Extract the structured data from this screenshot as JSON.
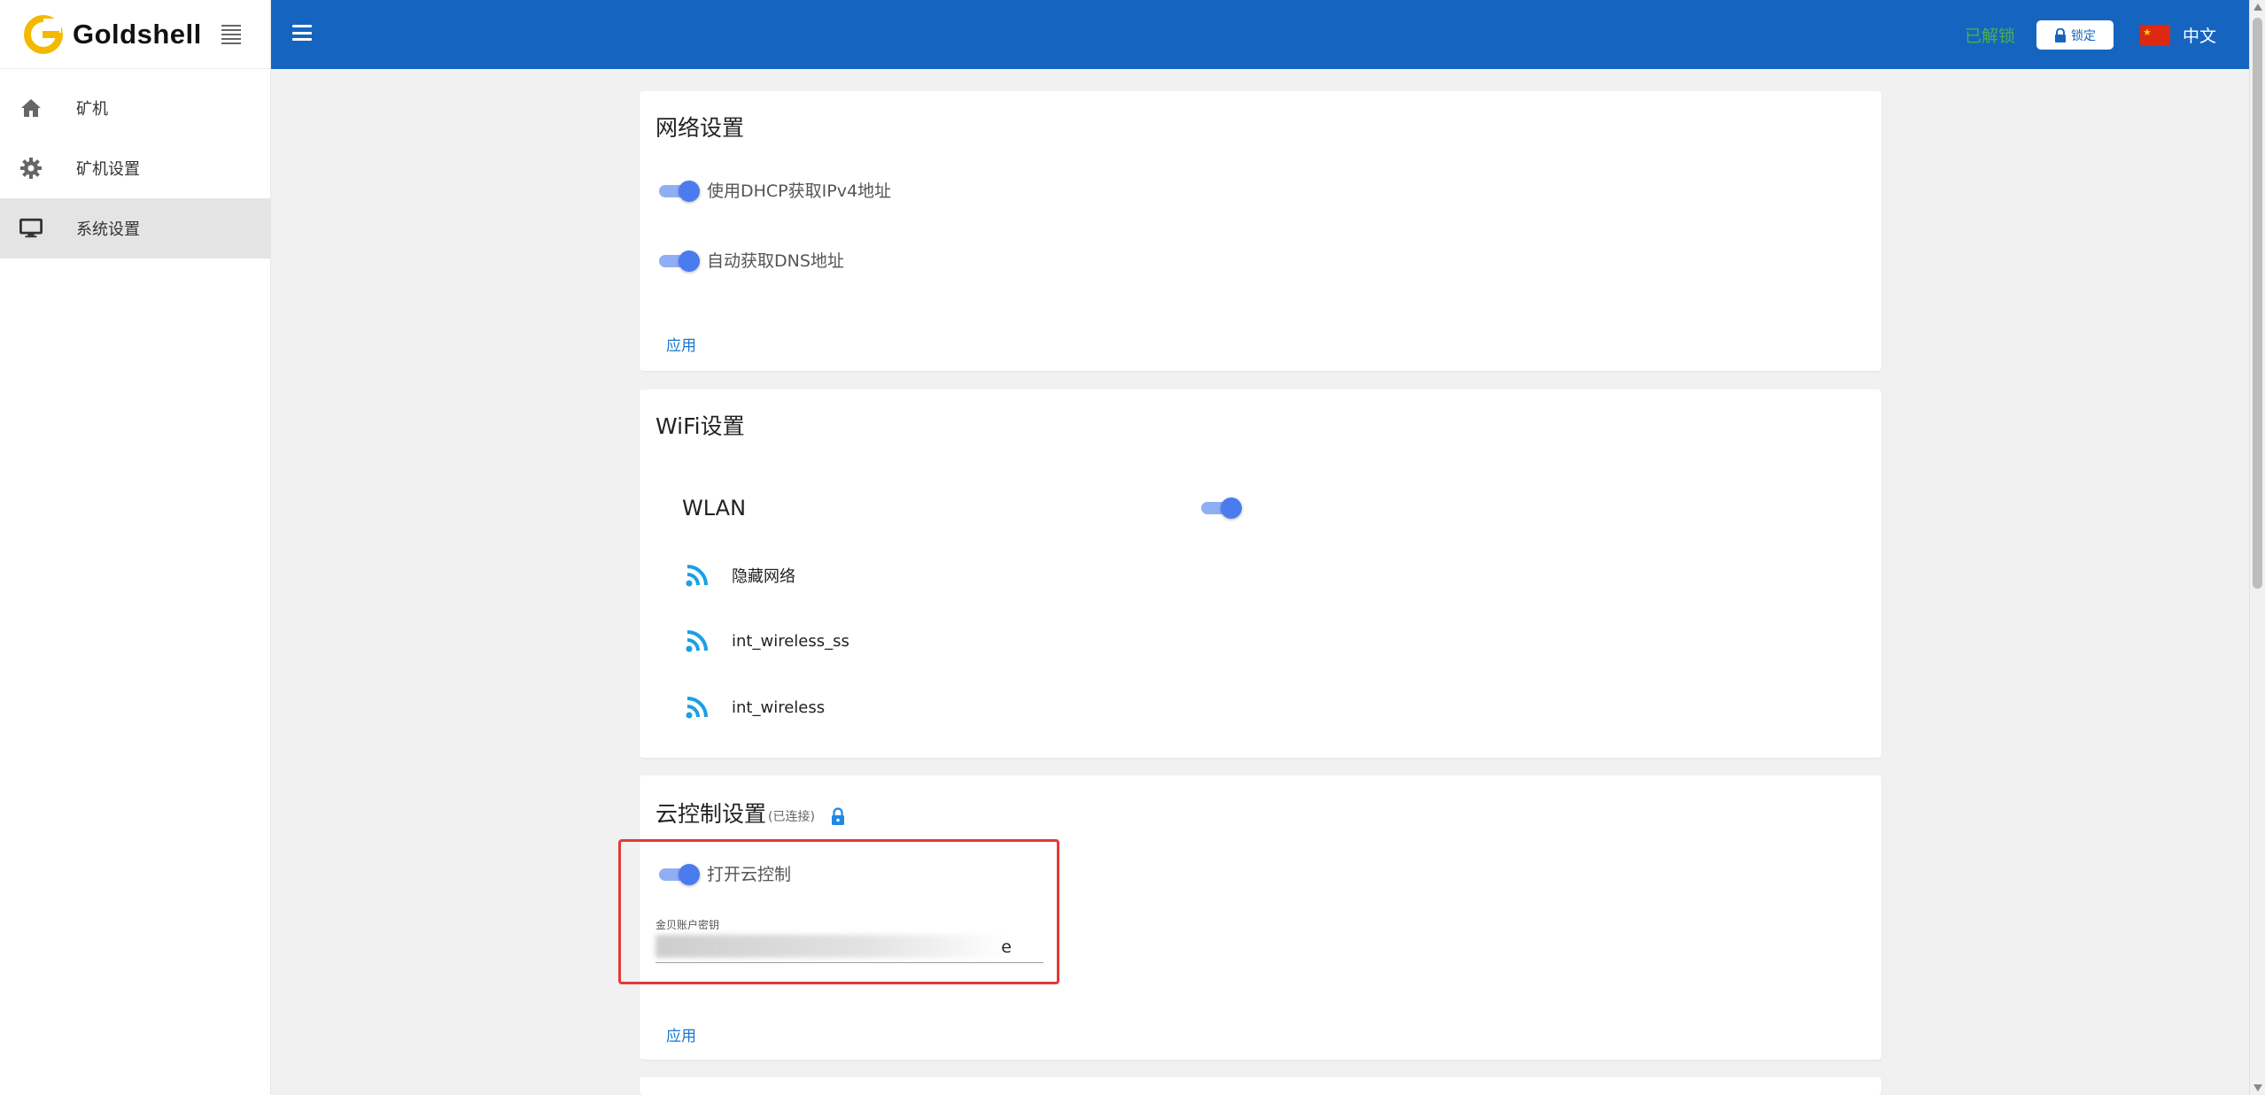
{
  "brand": {
    "name": "Goldshell"
  },
  "sidebar": {
    "items": [
      {
        "label": "矿机",
        "icon": "home-icon"
      },
      {
        "label": "矿机设置",
        "icon": "gear-icon"
      },
      {
        "label": "系统设置",
        "icon": "monitor-icon",
        "active": true
      }
    ]
  },
  "header": {
    "status": "已解锁",
    "lock_label": "锁定",
    "language": "中文"
  },
  "network": {
    "title": "网络设置",
    "dhcp_label": "使用DHCP获取IPv4地址",
    "dhcp_on": true,
    "dns_label": "自动获取DNS地址",
    "dns_on": true,
    "apply": "应用"
  },
  "wifi": {
    "title": "WiFi设置",
    "wlan_label": "WLAN",
    "wlan_on": true,
    "networks": [
      "隐藏网络",
      "int_wireless_ss",
      "int_wireless"
    ]
  },
  "cloud": {
    "title": "云控制设置",
    "status": "(已连接)",
    "toggle_label": "打开云控制",
    "toggle_on": true,
    "key_label": "金贝账户密钥",
    "key_value": "e",
    "apply": "应用"
  },
  "colors": {
    "header": "#1565c0",
    "accent": "#4a7cf0",
    "unlocked": "#4caf50",
    "highlight": "#e53935"
  }
}
